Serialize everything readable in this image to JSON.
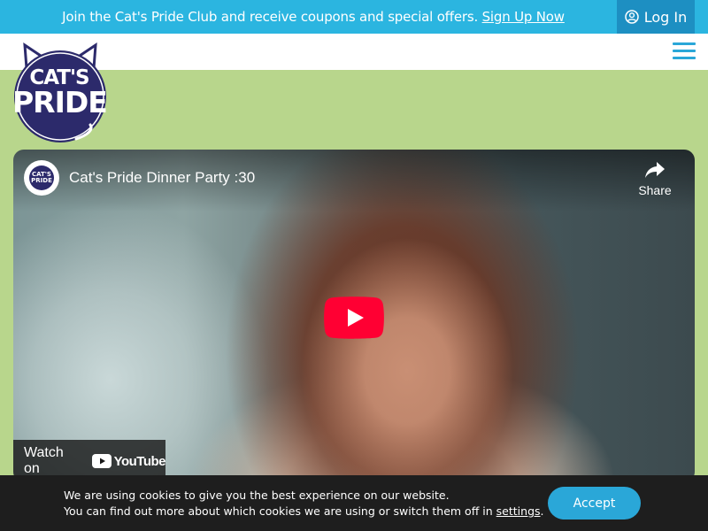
{
  "promo": {
    "message": "Join the Cat's Pride Club and receive coupons and special offers.",
    "link_label": "Sign Up Now",
    "login_label": "Log In",
    "login_icon": "user-circle-icon",
    "background": "#2bb5e0"
  },
  "header": {
    "logo_line1": "CAT'S",
    "logo_line2": "PRIDE",
    "menu_icon": "hamburger-menu-icon",
    "accent": "#2aa7d8"
  },
  "hero": {
    "background": "#b8d68c"
  },
  "video": {
    "channel_avatar_text": "CAT'S PRIDE",
    "title": "Cat's Pride Dinner Party :30",
    "share_label": "Share",
    "play_icon": "youtube-play-icon",
    "watch_on_label": "Watch on",
    "youtube_label": "YouTube"
  },
  "cookie": {
    "line1": "We are using cookies to give you the best experience on our website.",
    "line2_prefix": "You can find out more about which cookies we are using or switch them off in",
    "settings_link": "settings",
    "line2_suffix": ".",
    "accept_label": "Accept"
  }
}
